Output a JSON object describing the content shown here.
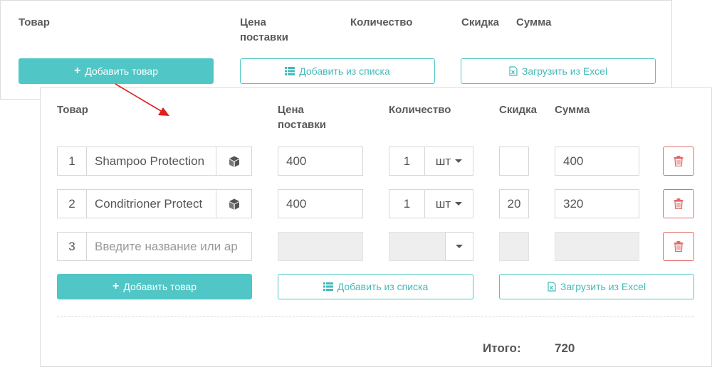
{
  "columns": {
    "product": "Товар",
    "price_line1": "Цена",
    "price_line2": "поставки",
    "quantity": "Количество",
    "discount": "Скидка",
    "sum": "Сумма"
  },
  "buttons": {
    "add_product": "Добавить товар",
    "add_from_list": "Добавить из списка",
    "load_excel": "Загрузить из Excel"
  },
  "rows": [
    {
      "index": "1",
      "name": "Shampoo Protection",
      "price": "400",
      "quantity": "1",
      "unit": "шт",
      "discount": "",
      "sum": "400"
    },
    {
      "index": "2",
      "name": "Conditrioner Protect",
      "price": "400",
      "quantity": "1",
      "unit": "шт",
      "discount": "20",
      "sum": "320"
    },
    {
      "index": "3",
      "name_placeholder": "Введите название или ар",
      "price": "",
      "quantity": "",
      "unit": "",
      "discount": "",
      "sum": ""
    }
  ],
  "total": {
    "label": "Итого:",
    "value": "720"
  },
  "colors": {
    "accent": "#50c6c6",
    "danger": "#e06b6b",
    "arrow": "#e0201b"
  },
  "icons": {
    "plus": "plus-icon",
    "list": "list-icon",
    "excel": "excel-file-icon",
    "cube": "cube-icon",
    "trash": "trash-icon",
    "caret": "caret-down-icon"
  }
}
